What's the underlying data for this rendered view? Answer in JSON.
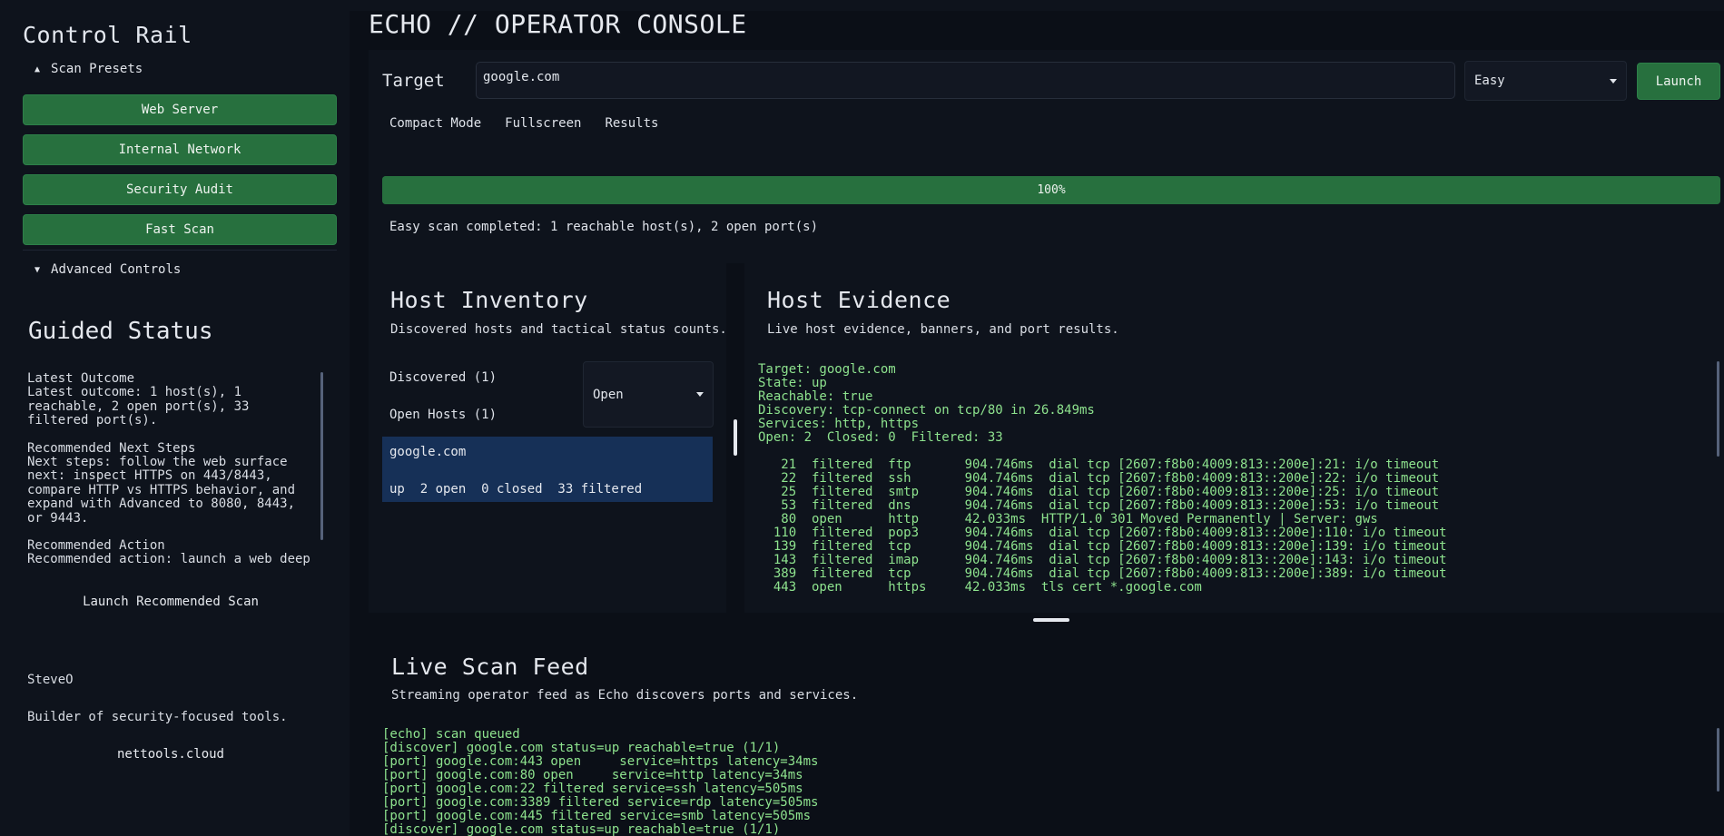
{
  "sidebar": {
    "title": "Control Rail",
    "presets_label": "Scan Presets",
    "presets": [
      "Web Server",
      "Internal Network",
      "Security Audit",
      "Fast Scan"
    ],
    "advanced_label": "Advanced Controls",
    "guided": {
      "title": "Guided Status",
      "latest_heading": "Latest Outcome",
      "latest_text": "Latest outcome: 1 host(s), 1 reachable, 2 open port(s), 33 filtered port(s).",
      "next_heading": "Recommended Next Steps",
      "next_text": "Next steps: follow the web surface next: inspect HTTPS on 443/8443, compare HTTP vs HTTPS behavior, and expand with Advanced to 8080, 8443, or 9443.",
      "action_heading": "Recommended Action",
      "action_text": "Recommended action: launch a web deep"
    },
    "launch_recommended": "Launch Recommended Scan",
    "author": "SteveO",
    "author_bio": "Builder of security-focused tools.",
    "author_link": "nettools.cloud"
  },
  "header": {
    "title": "ECHO // OPERATOR CONSOLE"
  },
  "scan": {
    "target_label": "Target",
    "target_value": "google.com",
    "mode_value": "Easy",
    "launch_label": "Launch",
    "tabs": [
      "Compact Mode",
      "Fullscreen",
      "Results"
    ],
    "progress": 1.0,
    "progress_label": "100%",
    "status": "Easy scan completed: 1 reachable host(s), 2 open port(s)"
  },
  "inventory": {
    "title": "Host Inventory",
    "subtitle": "Discovered hosts and tactical status counts.",
    "discovered": "Discovered (1)",
    "open_hosts": "Open Hosts (1)",
    "filter_value": "Open",
    "host": {
      "name": "google.com",
      "stats": "up  2 open  0 closed  33 filtered"
    }
  },
  "evidence": {
    "title": "Host Evidence",
    "subtitle": "Live host evidence, banners, and port results.",
    "summary": [
      "Target: google.com",
      "State: up",
      "Reachable: true",
      "Discovery: tcp-connect on tcp/80 in 26.849ms",
      "Services: http, https",
      "Open: 2  Closed: 0  Filtered: 33"
    ],
    "ports": [
      "   21  filtered  ftp       904.746ms  dial tcp [2607:f8b0:4009:813::200e]:21: i/o timeout",
      "   22  filtered  ssh       904.746ms  dial tcp [2607:f8b0:4009:813::200e]:22: i/o timeout",
      "   25  filtered  smtp      904.746ms  dial tcp [2607:f8b0:4009:813::200e]:25: i/o timeout",
      "   53  filtered  dns       904.746ms  dial tcp [2607:f8b0:4009:813::200e]:53: i/o timeout",
      "   80  open      http      42.033ms  HTTP/1.0 301 Moved Permanently | Server: gws",
      "  110  filtered  pop3      904.746ms  dial tcp [2607:f8b0:4009:813::200e]:110: i/o timeout",
      "  139  filtered  tcp       904.746ms  dial tcp [2607:f8b0:4009:813::200e]:139: i/o timeout",
      "  143  filtered  imap      904.746ms  dial tcp [2607:f8b0:4009:813::200e]:143: i/o timeout",
      "  389  filtered  tcp       904.746ms  dial tcp [2607:f8b0:4009:813::200e]:389: i/o timeout",
      "  443  open      https     42.033ms  tls cert *.google.com"
    ]
  },
  "feed": {
    "title": "Live Scan Feed",
    "subtitle": "Streaming operator feed as Echo discovers ports and services.",
    "lines": [
      "[echo] scan queued",
      "[discover] google.com status=up reachable=true (1/1)",
      "[port] google.com:443 open     service=https latency=34ms",
      "[port] google.com:80 open     service=http latency=34ms",
      "[port] google.com:22 filtered service=ssh latency=505ms",
      "[port] google.com:3389 filtered service=rdp latency=505ms",
      "[port] google.com:445 filtered service=smb latency=505ms",
      "[discover] google.com status=up reachable=true (1/1)"
    ]
  },
  "colors": {
    "accent_green": "#27703e",
    "terminal_green": "#8ee38e",
    "selection_blue": "#163057",
    "background": "#0b0f17"
  }
}
